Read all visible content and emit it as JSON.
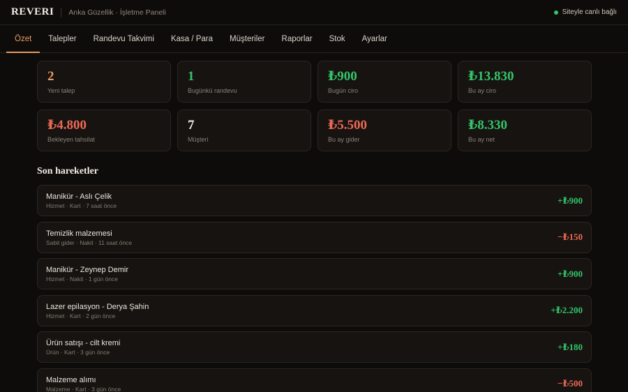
{
  "header": {
    "brand": "REVERI",
    "business": "Anka Güzellik · İşletme Paneli",
    "status": "Siteyle canlı bağlı",
    "status_color": "#34c46a"
  },
  "tabs": [
    {
      "label": "Özet",
      "active": true
    },
    {
      "label": "Talepler"
    },
    {
      "label": "Randevu Takvimi"
    },
    {
      "label": "Kasa / Para"
    },
    {
      "label": "Müşteriler"
    },
    {
      "label": "Raporlar"
    },
    {
      "label": "Stok"
    },
    {
      "label": "Ayarlar"
    }
  ],
  "stats": [
    {
      "value": "2",
      "label": "Yeni talep",
      "color": "#e79a63"
    },
    {
      "value": "1",
      "label": "Bugünkü randevu",
      "color": "#34c46a"
    },
    {
      "value": "₺900",
      "label": "Bugün ciro",
      "color": "#34c46a"
    },
    {
      "value": "₺13.830",
      "label": "Bu ay ciro",
      "color": "#34c46a"
    },
    {
      "value": "₺4.800",
      "label": "Bekleyen tahsilat",
      "color": "#ec6a55"
    },
    {
      "value": "7",
      "label": "Müşteri",
      "color": "#f4efe8"
    },
    {
      "value": "₺5.500",
      "label": "Bu ay gider",
      "color": "#ec6a55"
    },
    {
      "value": "₺8.330",
      "label": "Bu ay net",
      "color": "#34c46a"
    }
  ],
  "recent": {
    "title": "Son hareketler",
    "items": [
      {
        "title": "Manikür - Aslı Çelik",
        "meta": "Hizmet · Kart · 7 saat önce",
        "amount": "+₺900",
        "color": "#34c46a"
      },
      {
        "title": "Temizlik malzemesi",
        "meta": "Sabit gider · Nakit · 11 saat önce",
        "amount": "−₺150",
        "color": "#ec6a55"
      },
      {
        "title": "Manikür - Zeynep Demir",
        "meta": "Hizmet · Nakit · 1 gün önce",
        "amount": "+₺900",
        "color": "#34c46a"
      },
      {
        "title": "Lazer epilasyon - Derya Şahin",
        "meta": "Hizmet · Kart · 2 gün önce",
        "amount": "+₺2.200",
        "color": "#34c46a"
      },
      {
        "title": "Ürün satışı - cilt kremi",
        "meta": "Ürün · Kart · 3 gün önce",
        "amount": "+₺180",
        "color": "#34c46a"
      },
      {
        "title": "Malzeme alımı",
        "meta": "Malzeme · Kart · 3 gün önce",
        "amount": "−₺500",
        "color": "#ec6a55"
      }
    ]
  }
}
